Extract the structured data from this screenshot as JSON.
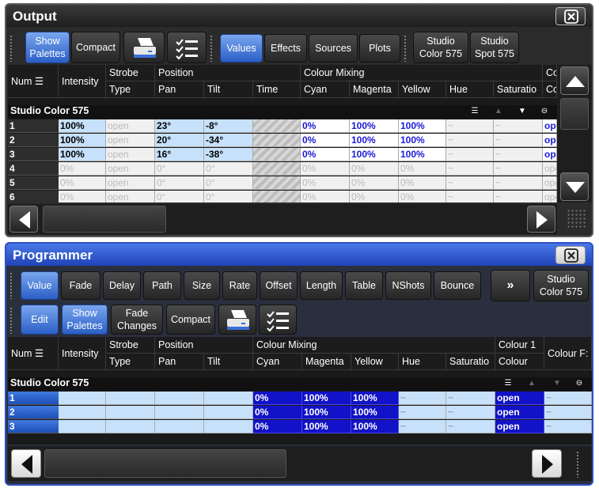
{
  "output": {
    "title": "Output",
    "toolbar": {
      "show_palettes": "Show\nPalettes",
      "compact": "Compact",
      "values": "Values",
      "effects": "Effects",
      "sources": "Sources",
      "plots": "Plots",
      "fixture1": "Studio\nColor 575",
      "fixture2": "Studio\nSpot 575"
    },
    "headers": {
      "num": "Num",
      "intensity": "Intensity",
      "strobe": "Strobe",
      "strobe_type": "Type",
      "position": "Position",
      "pan": "Pan",
      "tilt": "Tilt",
      "time": "Time",
      "colour_mixing": "Colour Mixing",
      "cyan": "Cyan",
      "magenta": "Magenta",
      "yellow": "Yellow",
      "hue": "Hue",
      "saturation": "Saturatio",
      "co": "Co",
      "co2": "Co"
    },
    "section": "Studio Color 575",
    "rows": [
      {
        "num": "1",
        "intensity": "100%",
        "strobe": "open",
        "pan": "23°",
        "tilt": "-8°",
        "cyan": "0%",
        "magenta": "100%",
        "yellow": "100%",
        "hue": "~",
        "sat": "~",
        "co": "ope",
        "active": true
      },
      {
        "num": "2",
        "intensity": "100%",
        "strobe": "open",
        "pan": "20°",
        "tilt": "-34°",
        "cyan": "0%",
        "magenta": "100%",
        "yellow": "100%",
        "hue": "~",
        "sat": "~",
        "co": "ope",
        "active": true
      },
      {
        "num": "3",
        "intensity": "100%",
        "strobe": "open",
        "pan": "16°",
        "tilt": "-38°",
        "cyan": "0%",
        "magenta": "100%",
        "yellow": "100%",
        "hue": "~",
        "sat": "~",
        "co": "ope",
        "active": true
      },
      {
        "num": "4",
        "intensity": "0%",
        "strobe": "open",
        "pan": "0°",
        "tilt": "0°",
        "cyan": "0%",
        "magenta": "0%",
        "yellow": "0%",
        "hue": "~",
        "sat": "~",
        "co": "ope",
        "active": false
      },
      {
        "num": "5",
        "intensity": "0%",
        "strobe": "open",
        "pan": "0°",
        "tilt": "0°",
        "cyan": "0%",
        "magenta": "0%",
        "yellow": "0%",
        "hue": "~",
        "sat": "~",
        "co": "ope",
        "active": false
      },
      {
        "num": "6",
        "intensity": "0%",
        "strobe": "open",
        "pan": "0°",
        "tilt": "0°",
        "cyan": "0%",
        "magenta": "0%",
        "yellow": "0%",
        "hue": "~",
        "sat": "~",
        "co": "ope",
        "active": false
      }
    ]
  },
  "programmer": {
    "title": "Programmer",
    "tabs": [
      "Value",
      "Fade",
      "Delay",
      "Path",
      "Size",
      "Rate",
      "Offset",
      "Length",
      "Table",
      "NShots",
      "Bounce"
    ],
    "more": "»",
    "fixture": "Studio\nColor 575",
    "toolbar": {
      "edit": "Edit",
      "show_palettes": "Show\nPalettes",
      "fade_changes": "Fade\nChanges",
      "compact": "Compact"
    },
    "headers": {
      "num": "Num",
      "intensity": "Intensity",
      "strobe": "Strobe",
      "strobe_type": "Type",
      "position": "Position",
      "pan": "Pan",
      "tilt": "Tilt",
      "colour_mixing": "Colour Mixing",
      "cyan": "Cyan",
      "magenta": "Magenta",
      "yellow": "Yellow",
      "hue": "Hue",
      "saturation": "Saturatio",
      "colour1": "Colour 1",
      "colour": "Colour",
      "colour_fx": "Colour F:"
    },
    "section": "Studio Color 575",
    "rows": [
      {
        "num": "1",
        "cyan": "0%",
        "magenta": "100%",
        "yellow": "100%",
        "hue": "~",
        "sat": "~",
        "colour": "open",
        "fx": "~"
      },
      {
        "num": "2",
        "cyan": "0%",
        "magenta": "100%",
        "yellow": "100%",
        "hue": "~",
        "sat": "~",
        "colour": "open",
        "fx": "~"
      },
      {
        "num": "3",
        "cyan": "0%",
        "magenta": "100%",
        "yellow": "100%",
        "hue": "~",
        "sat": "~",
        "colour": "open",
        "fx": "~"
      }
    ]
  },
  "colors": {
    "active_blue": "#2a5fc6",
    "cell_light_blue": "#c7e1fb",
    "cell_dark_blue": "#1212c8",
    "value_blue_text": "#1a1ad6"
  }
}
